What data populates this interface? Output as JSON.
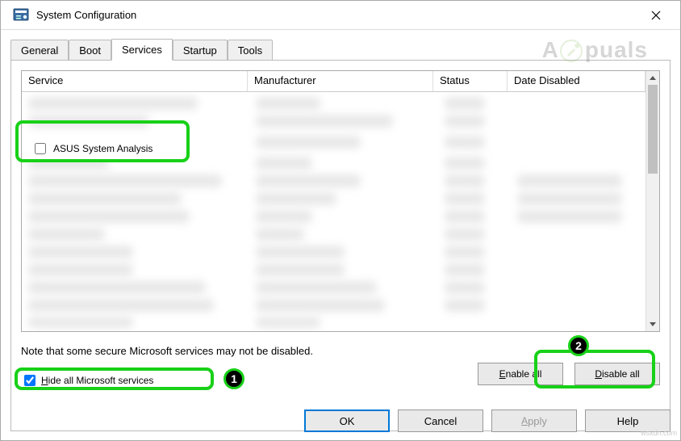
{
  "window": {
    "title": "System Configuration"
  },
  "tabs": {
    "general": "General",
    "boot": "Boot",
    "services": "Services",
    "startup": "Startup",
    "tools": "Tools",
    "active": "services"
  },
  "columns": {
    "service": "Service",
    "manufacturer": "Manufacturer",
    "status": "Status",
    "date_disabled": "Date Disabled"
  },
  "services": {
    "highlighted": {
      "label": "ASUS System Analysis",
      "checked": false
    }
  },
  "note": "Note that some secure Microsoft services may not be disabled.",
  "hide_checkbox": {
    "label": "Hide all Microsoft services",
    "checked": true
  },
  "buttons": {
    "enable_all": "Enable all",
    "disable_all": "Disable all",
    "ok": "OK",
    "cancel": "Cancel",
    "apply": "Apply",
    "help": "Help"
  },
  "annotations": {
    "badge1": "1",
    "badge2": "2"
  },
  "watermark": "A  puals",
  "corner": "wsxdn.com"
}
